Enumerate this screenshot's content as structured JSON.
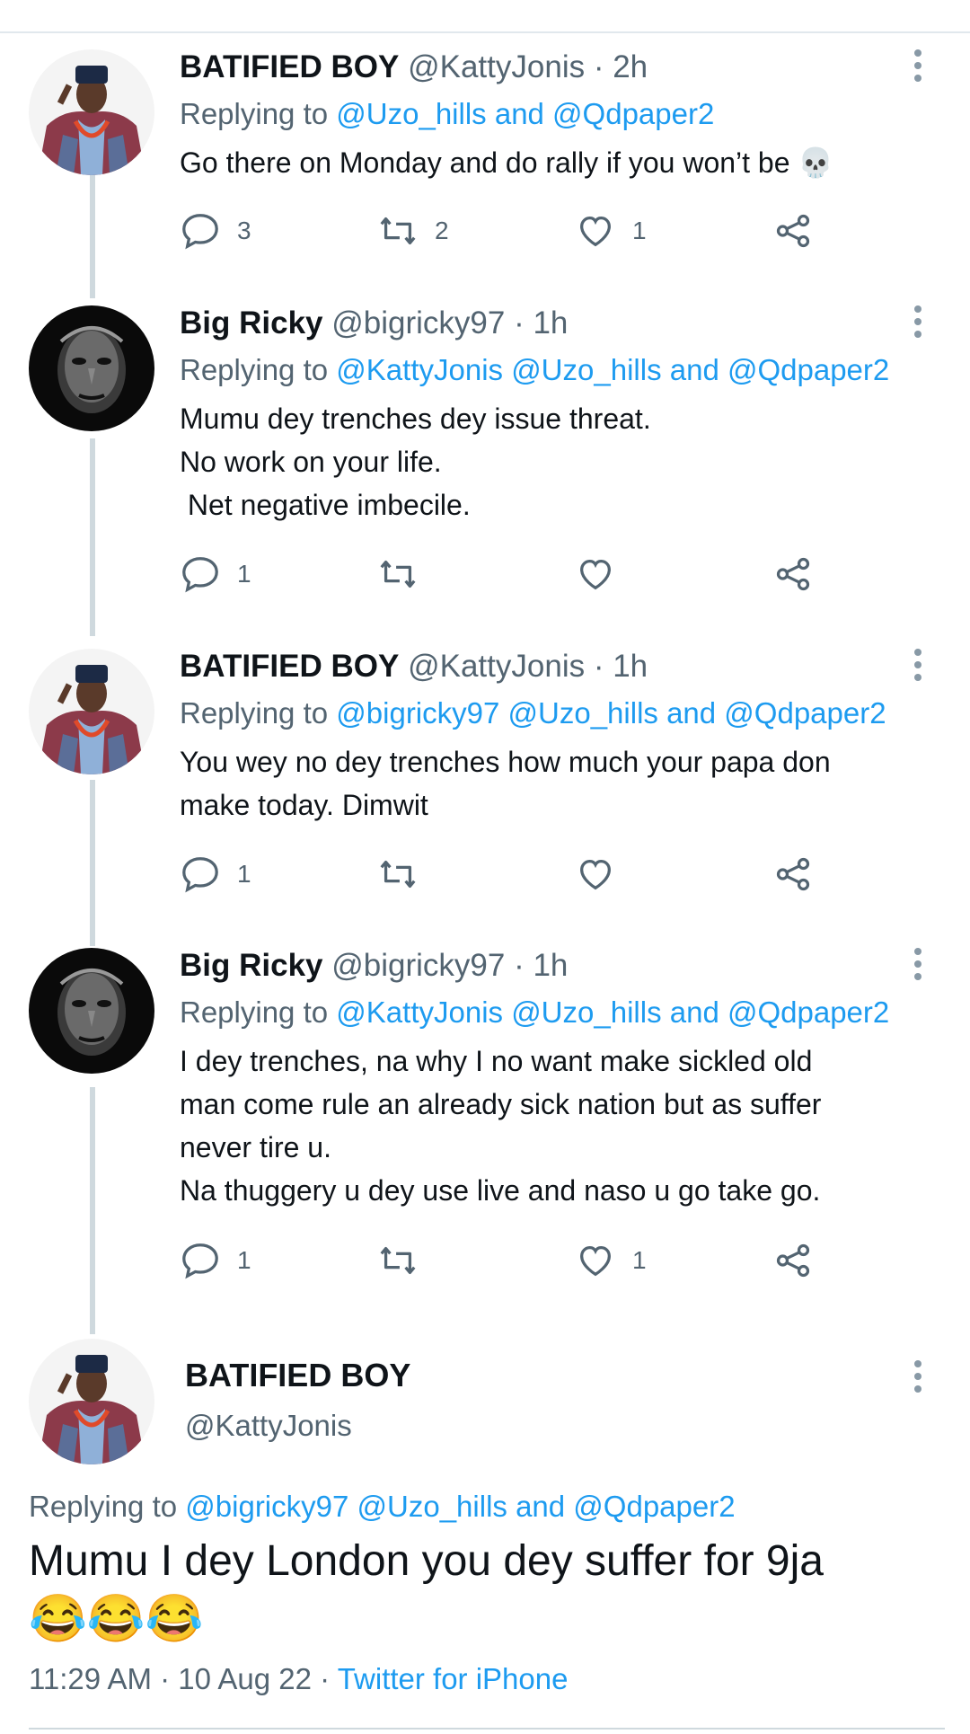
{
  "colors": {
    "accent": "#1d9bf0",
    "text": "#0f1419",
    "muted": "#536471",
    "thread": "#cfd9de"
  },
  "tweets": [
    {
      "name": "BATIFIED BOY",
      "handle": "@KattyJonis",
      "time": "· 2h",
      "replying_prefix": "Replying to",
      "replying_mentions": "@Uzo_hills and @Qdpaper2",
      "text": "Go there on Monday and do rally if you won’t be 💀",
      "replies": "3",
      "retweets": "2",
      "likes": "1",
      "avatar": "agbada-man-avatar"
    },
    {
      "name": "Big Ricky",
      "handle": "@bigricky97",
      "time": "· 1h",
      "replying_prefix": "Replying to",
      "replying_mentions": "@KattyJonis @Uzo_hills and @Qdpaper2",
      "text": "Mumu dey trenches dey issue threat.\nNo work on your life.\n Net negative imbecile.",
      "replies": "1",
      "retweets": "",
      "likes": "",
      "avatar": "monochrome-face-avatar"
    },
    {
      "name": "BATIFIED BOY",
      "handle": "@KattyJonis",
      "time": "· 1h",
      "replying_prefix": "Replying to",
      "replying_mentions": "@bigricky97 @Uzo_hills and @Qdpaper2",
      "text": "You wey no dey trenches how much your papa don\nmake today. Dimwit",
      "replies": "1",
      "retweets": "",
      "likes": "",
      "avatar": "agbada-man-avatar"
    },
    {
      "name": "Big Ricky",
      "handle": "@bigricky97",
      "time": "· 1h",
      "replying_prefix": "Replying to",
      "replying_mentions": "@KattyJonis @Uzo_hills and @Qdpaper2",
      "text": "I dey trenches, na why I no want make sickled old\nman come rule an already sick nation but as suffer\nnever tire u.\nNa thuggery u dey use live and naso u go take go.",
      "replies": "1",
      "retweets": "",
      "likes": "1",
      "avatar": "monochrome-face-avatar"
    }
  ],
  "focus_tweet": {
    "name": "BATIFIED BOY",
    "handle": "@KattyJonis",
    "replying_prefix": "Replying to",
    "replying_mentions": "@bigricky97 @Uzo_hills and @Qdpaper2",
    "text": "Mumu I dey London you dey suffer for 9ja",
    "emoji": "😂😂😂",
    "timestamp": "11:29 AM · 10 Aug 22 · ",
    "source": "Twitter for iPhone"
  }
}
